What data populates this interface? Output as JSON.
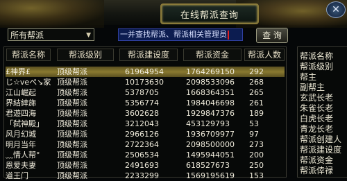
{
  "window": {
    "title": "在线帮派查询",
    "close": "✕"
  },
  "filter": {
    "selected": "所有帮派"
  },
  "search": {
    "value": "一并查找帮派、帮派相关管理员"
  },
  "query_button": "查 询",
  "table": {
    "headers": [
      "帮派名称",
      "帮派级别",
      "帮派建设度",
      "帮派资金",
      "帮派人数"
    ],
    "rows": [
      {
        "name": "£神界£",
        "level": "顶级帮派",
        "progress": "61964954",
        "funds": "1764269150",
        "members": "292",
        "selected": true
      },
      {
        "name": "じ☆veぺ↘家",
        "level": "顶级帮派",
        "progress": "10173630",
        "funds": "2098533096",
        "members": "268"
      },
      {
        "name": "江山崛起",
        "level": "顶级帮派",
        "progress": "5378705",
        "funds": "1668364351",
        "members": "265"
      },
      {
        "name": "界結緈旆",
        "level": "顶级帮派",
        "progress": "5356774",
        "funds": "1984046698",
        "members": "261"
      },
      {
        "name": "君遊四海",
        "level": "顶级帮派",
        "progress": "3602628",
        "funds": "1929847376",
        "members": "189"
      },
      {
        "name": "「弑神殿」",
        "level": "顶级帮派",
        "progress": "3212043",
        "funds": "453129793",
        "members": "53"
      },
      {
        "name": "风月幻城",
        "level": "顶级帮派",
        "progress": "2966126",
        "funds": "1936709977",
        "members": "97"
      },
      {
        "name": "明月当年",
        "level": "顶级帮派",
        "progress": "2722364",
        "funds": "2098500000",
        "members": "273"
      },
      {
        "name": "﹏情人帮°",
        "level": "顶级帮派",
        "progress": "2506534",
        "funds": "1495944051",
        "members": "200"
      },
      {
        "name": "恩爱夫妻",
        "level": "顶级帮派",
        "progress": "2491693",
        "funds": "618527673",
        "members": "250"
      },
      {
        "name": "道王门",
        "level": "顶级帮派",
        "progress": "2233299",
        "funds": "1569195619",
        "members": "153"
      }
    ]
  },
  "info": {
    "labels": [
      "帮派名称",
      "帮派级别",
      "帮主",
      "副帮主",
      "玄武长老",
      "朱雀长老",
      "白虎长老",
      "青龙长老",
      "帮派创建人",
      "帮派建设度",
      "帮派资金",
      "帮派倖禄"
    ]
  }
}
